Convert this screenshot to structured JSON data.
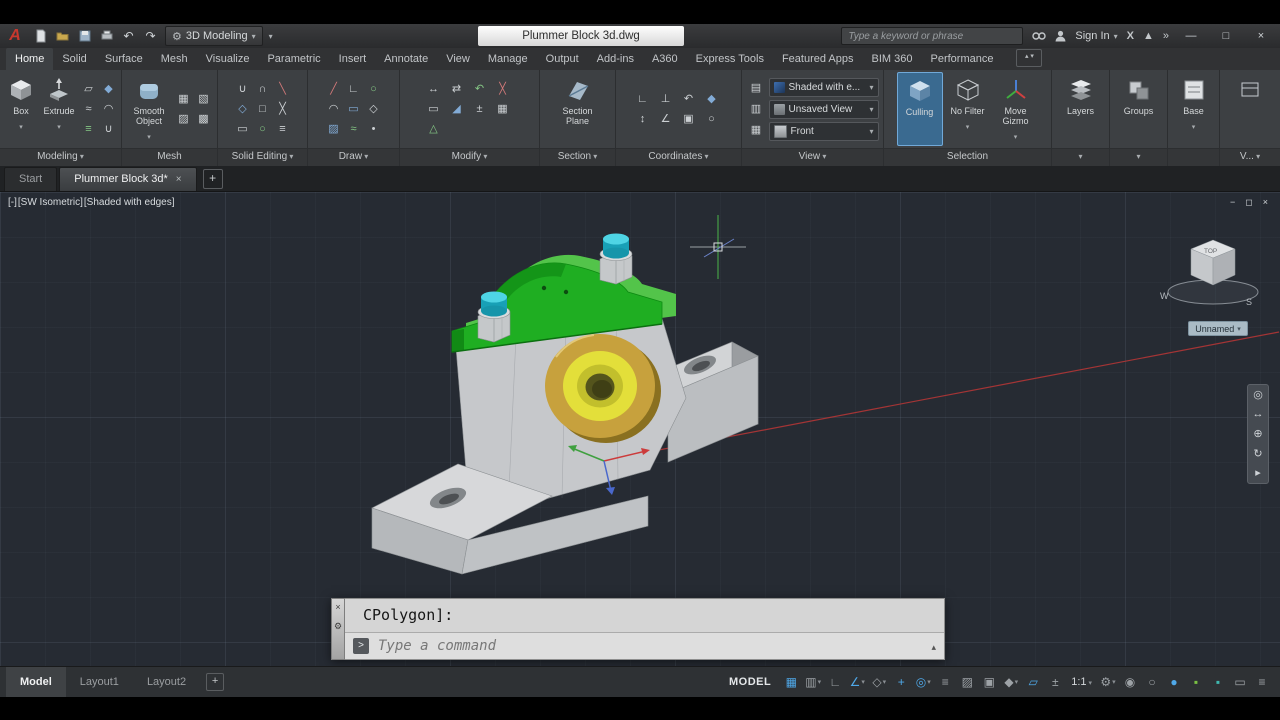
{
  "titlebar": {
    "workspace": "3D Modeling",
    "doc_title": "Plummer Block 3d.dwg",
    "search_placeholder": "Type a keyword or phrase",
    "sign_in": "Sign In",
    "glyphs": {
      "undo": "↶",
      "redo": "↷",
      "gear": "⚙",
      "exchange": "X",
      "a360": "▲",
      "overflow": "»",
      "minimize": "—",
      "restore": "□",
      "close": "×"
    }
  },
  "ribbon": {
    "tabs": [
      "Home",
      "Solid",
      "Surface",
      "Mesh",
      "Visualize",
      "Parametric",
      "Insert",
      "Annotate",
      "View",
      "Manage",
      "Output",
      "Add-ins",
      "A360",
      "Express Tools",
      "Featured Apps",
      "BIM 360",
      "Performance"
    ],
    "active_tab": "Home",
    "panels": {
      "modeling": {
        "label": "Modeling",
        "big": [
          {
            "label": "Box"
          },
          {
            "label": "Extrude"
          }
        ],
        "items": [
          {
            "name": "polysolid-icon",
            "glyph": "▱"
          },
          {
            "name": "presspull-icon",
            "glyph": "◆"
          },
          {
            "name": "sweep-icon",
            "glyph": "≈"
          },
          {
            "name": "revolve-icon",
            "glyph": "◠"
          },
          {
            "name": "loft-icon",
            "glyph": "≡"
          },
          {
            "name": "union-icon",
            "glyph": "∪"
          }
        ]
      },
      "mesh": {
        "label": "Mesh",
        "big": [
          {
            "label": "Smooth Object"
          }
        ],
        "items": [
          {
            "name": "mesh-box-icon",
            "glyph": "▦"
          },
          {
            "name": "smooth-more-icon",
            "glyph": "▧"
          },
          {
            "name": "refine-mesh-icon",
            "glyph": "▨"
          },
          {
            "name": "add-crease-icon",
            "glyph": "▩"
          }
        ]
      },
      "solid_editing": {
        "label": "Solid Editing",
        "items": [
          {
            "name": "solid-union-icon",
            "glyph": "∪"
          },
          {
            "name": "solid-subtract-icon",
            "glyph": "∩"
          },
          {
            "name": "solid-slice-icon",
            "glyph": "╲"
          },
          {
            "name": "solid-fillet-edge-icon",
            "glyph": "◇"
          },
          {
            "name": "solid-taper-face-icon",
            "glyph": "□"
          },
          {
            "name": "solid-interfere-icon",
            "glyph": "╳"
          },
          {
            "name": "solid-shell-icon",
            "glyph": "▭"
          },
          {
            "name": "solid-separate-icon",
            "glyph": "○"
          },
          {
            "name": "solid-check-icon",
            "glyph": "≡"
          }
        ]
      },
      "draw": {
        "label": "Draw",
        "items": [
          {
            "name": "line-icon",
            "glyph": "╱"
          },
          {
            "name": "polyline-icon",
            "glyph": "∟"
          },
          {
            "name": "circle-icon",
            "glyph": "○"
          },
          {
            "name": "arc-icon",
            "glyph": "◠"
          },
          {
            "name": "rectangle-icon",
            "glyph": "▭"
          },
          {
            "name": "ellipse-icon",
            "glyph": "◇"
          },
          {
            "name": "hatch-icon",
            "glyph": "▨"
          },
          {
            "name": "spline-icon",
            "glyph": "≈"
          },
          {
            "name": "point-icon",
            "glyph": "•"
          }
        ]
      },
      "modify": {
        "label": "Modify",
        "items": [
          {
            "name": "move-icon",
            "glyph": "↔"
          },
          {
            "name": "copy-icon",
            "glyph": "⇄"
          },
          {
            "name": "rotate-icon",
            "glyph": "↶"
          },
          {
            "name": "trim-icon",
            "glyph": "╳"
          },
          {
            "name": "erase-icon",
            "glyph": "▭"
          },
          {
            "name": "mirror-icon",
            "glyph": "◢"
          },
          {
            "name": "offset-icon",
            "glyph": "±"
          },
          {
            "name": "array-icon",
            "glyph": "▦"
          },
          {
            "name": "explode-icon",
            "glyph": "△"
          }
        ]
      },
      "section": {
        "label": "Section",
        "big": [
          {
            "label": "Section Plane"
          }
        ]
      },
      "coordinates": {
        "label": "Coordinates",
        "items": [
          {
            "name": "world-ucs-icon",
            "glyph": "∟"
          },
          {
            "name": "ucs-icon",
            "glyph": "⊥"
          },
          {
            "name": "ucs-previous-icon",
            "glyph": "↶"
          },
          {
            "name": "ucs-origin-icon",
            "glyph": "◆"
          },
          {
            "name": "ucs-z-axis-icon",
            "glyph": "↕"
          },
          {
            "name": "ucs-3point-icon",
            "glyph": "∠"
          },
          {
            "name": "ucs-view-icon",
            "glyph": "▣"
          },
          {
            "name": "ucs-object-icon",
            "glyph": "○"
          }
        ]
      },
      "view": {
        "label": "View",
        "combos": [
          {
            "name": "visual-style-select",
            "value": "Shaded with e..."
          },
          {
            "name": "named-view-select",
            "value": "Unsaved View"
          },
          {
            "name": "viewport-select",
            "value": "Front"
          }
        ],
        "items": [
          {
            "name": "view-manager-icon",
            "glyph": "▤"
          },
          {
            "name": "viewport-config-icon",
            "glyph": "▥"
          },
          {
            "name": "named-views-icon",
            "glyph": "▦"
          }
        ]
      },
      "selection": {
        "label": "Selection",
        "big": [
          {
            "label": "Culling"
          },
          {
            "label": "No Filter"
          },
          {
            "label": "Move Gizmo"
          }
        ]
      },
      "layers": {
        "label": "Layers"
      },
      "groups": {
        "label": "Groups"
      },
      "base": {
        "label": "Base"
      },
      "partial": {
        "label": "V..."
      }
    }
  },
  "file_tabs": {
    "start": "Start",
    "active": "Plummer Block 3d*"
  },
  "viewport": {
    "controls_label": "[-]",
    "view_label": "[SW Isometric]",
    "style_label": "[Shaded with edges]",
    "viewcube": {
      "top": "TOP",
      "west": "W",
      "south": "S",
      "view_name": "Unnamed"
    }
  },
  "command": {
    "history": "CPolygon]:",
    "placeholder": "Type a command"
  },
  "layout_tabs": {
    "model": "Model",
    "layout1": "Layout1",
    "layout2": "Layout2"
  },
  "statusbar": {
    "model_label": "MODEL",
    "scale_label": "1:1",
    "icons": [
      {
        "name": "grid-display-icon",
        "glyph": "▦",
        "active": true
      },
      {
        "name": "snap-mode-icon",
        "glyph": "▥",
        "active": false
      },
      {
        "name": "ortho-mode-icon",
        "glyph": "∟",
        "active": false
      },
      {
        "name": "polar-tracking-icon",
        "glyph": "∠",
        "active": true
      },
      {
        "name": "isometric-drafting-icon",
        "glyph": "◇",
        "active": false
      },
      {
        "name": "object-snap-tracking-icon",
        "glyph": "+",
        "active": true
      },
      {
        "name": "object-snap-icon",
        "glyph": "◎",
        "active": true
      },
      {
        "name": "lineweight-icon",
        "glyph": "≡",
        "active": false
      },
      {
        "name": "transparency-icon",
        "glyph": "▨",
        "active": false
      },
      {
        "name": "selection-cycling-icon",
        "glyph": "▣",
        "active": false
      },
      {
        "name": "object-snap-3d-icon",
        "glyph": "◆",
        "active": false
      },
      {
        "name": "dynamic-ucs-icon",
        "glyph": "▱",
        "active": true
      },
      {
        "name": "dynamic-input-icon",
        "glyph": "±",
        "active": false
      },
      {
        "name": "workspace-switching-icon",
        "glyph": "⚙",
        "active": false
      },
      {
        "name": "annotation-monitor-icon",
        "glyph": "◉",
        "active": false
      },
      {
        "name": "isolate-objects-icon",
        "glyph": "○",
        "active": false
      },
      {
        "name": "graphics-performance-icon",
        "glyph": "●",
        "active": true
      },
      {
        "name": "app-tray-green-icon",
        "glyph": "▪",
        "active": false
      },
      {
        "name": "app-tray-teal-icon",
        "glyph": "▪",
        "active": false
      },
      {
        "name": "clean-screen-icon",
        "glyph": "▭",
        "active": false
      },
      {
        "name": "customization-icon",
        "glyph": "≡",
        "active": false
      }
    ]
  },
  "nav_bar": {
    "icons": [
      {
        "name": "navigation-wheel-icon",
        "glyph": "◎"
      },
      {
        "name": "pan-icon",
        "glyph": "↔"
      },
      {
        "name": "zoom-icon",
        "glyph": "⊕"
      },
      {
        "name": "orbit-icon",
        "glyph": "↻"
      },
      {
        "name": "showmotion-icon",
        "glyph": "▸"
      }
    ]
  }
}
